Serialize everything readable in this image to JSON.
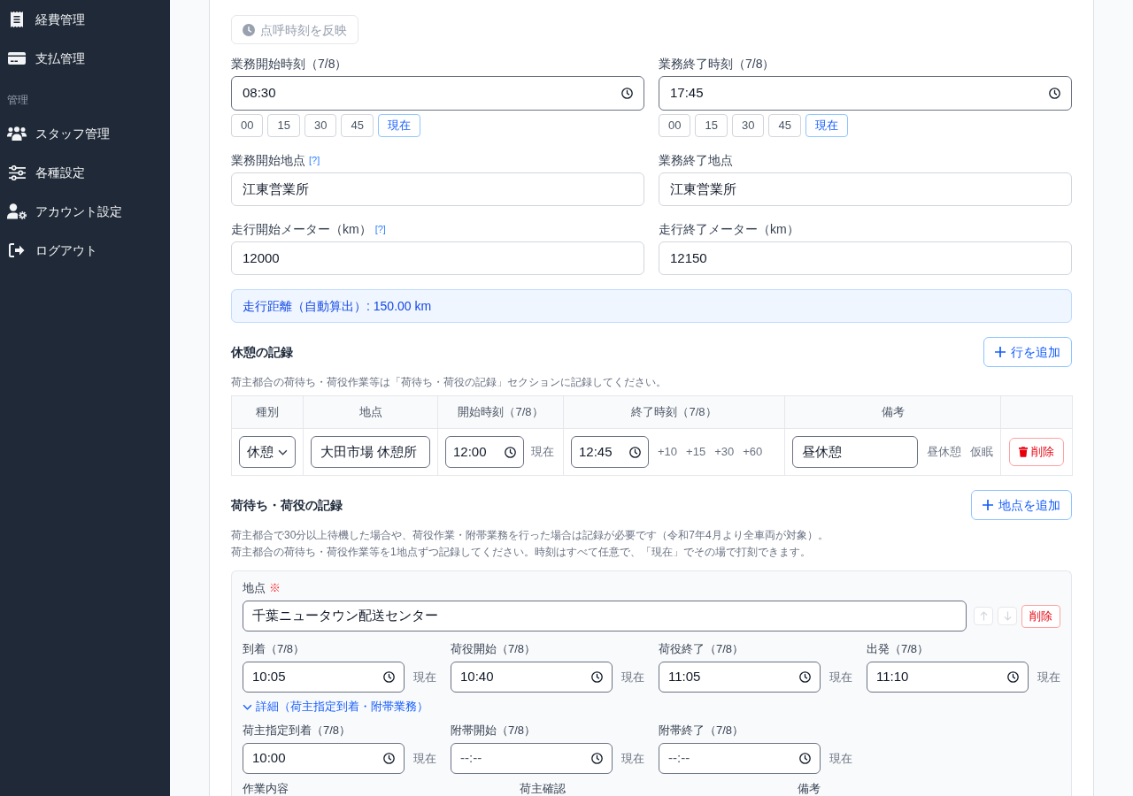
{
  "sidebar": {
    "items": [
      {
        "kind": "link",
        "label": "経費管理",
        "selected": false
      },
      {
        "kind": "link",
        "label": "支払管理",
        "selected": false
      },
      {
        "kind": "section",
        "label": "管理"
      },
      {
        "kind": "link",
        "label": "スタッフ管理",
        "selected": false
      },
      {
        "kind": "link",
        "label": "各種設定",
        "selected": false
      },
      {
        "kind": "link",
        "label": "アカウント設定",
        "selected": false
      },
      {
        "kind": "link",
        "label": "ログアウト",
        "selected": false
      }
    ]
  },
  "roll_call_button": {
    "label": "点呼時刻を反映",
    "disabled": true
  },
  "work_fields": [
    {
      "kind": "time",
      "label": "業務開始時刻（7/8）",
      "value": "08:30",
      "quick_buttons": [
        {
          "kind": "minute",
          "label": "00"
        },
        {
          "kind": "minute",
          "label": "15"
        },
        {
          "kind": "minute",
          "label": "30"
        },
        {
          "kind": "minute",
          "label": "45"
        },
        {
          "kind": "now",
          "label": "現在"
        }
      ]
    },
    {
      "kind": "time",
      "label": "業務終了時刻（7/8）",
      "value": "17:45",
      "quick_buttons": [
        {
          "kind": "minute",
          "label": "00"
        },
        {
          "kind": "minute",
          "label": "15"
        },
        {
          "kind": "minute",
          "label": "30"
        },
        {
          "kind": "minute",
          "label": "45"
        },
        {
          "kind": "now",
          "label": "現在"
        }
      ]
    },
    {
      "kind": "text",
      "label": "業務開始地点",
      "help": "[?]",
      "value": "江東営業所"
    },
    {
      "kind": "text",
      "label": "業務終了地点",
      "value": "江東営業所"
    },
    {
      "kind": "text",
      "label": "走行開始メーター（km）",
      "help": "[?]",
      "value": "12000"
    },
    {
      "kind": "text",
      "label": "走行終了メーター（km）",
      "value": "12150"
    }
  ],
  "distance_notice": "走行距離（自動算出）: 150.00 km",
  "break_records": {
    "title": "休憩の記録",
    "add_button": "行を追加",
    "note": "荷主都合の荷待ち・荷役作業等は「荷待ち・荷役の記録」セクションに記録してください。",
    "table": {
      "columns": [
        "種別",
        "地点",
        "開始時刻（7/8）",
        "終了時刻（7/8）",
        "備考"
      ],
      "rows": [
        {
          "type": "休憩",
          "location": "大田市場 休憩所",
          "start_time": "12:00",
          "start_now_button": "現在",
          "end_time": "12:45",
          "end_offsets": [
            "+10",
            "+15",
            "+30",
            "+60"
          ],
          "remark": "昼休憩",
          "remark_presets": [
            "昼休憩",
            "仮眠"
          ],
          "delete_button": "削除"
        }
      ]
    }
  },
  "waiting_records": {
    "title": "荷待ち・荷役の記録",
    "add_button": "地点を追加",
    "notes": [
      "荷主都合で30分以上待機した場合や、荷役作業・附帯業務を行った場合は記録が必要です（令和7年4月より全車両が対象）。",
      "荷主都合の荷待ち・荷役作業等を1地点ずつ記録してください。時刻はすべて任意で、「現在」でその場で打刻できます。"
    ],
    "stops": [
      {
        "location_label": "地点",
        "required_mark": "※",
        "location": "千葉ニュータウン配送センター",
        "move_up": {
          "disabled": true
        },
        "move_down": {
          "disabled": true
        },
        "delete_button": "削除",
        "times": [
          {
            "label": "到着（7/8）",
            "value": "10:05",
            "now_button": "現在"
          },
          {
            "label": "荷役開始（7/8）",
            "value": "10:40",
            "now_button": "現在"
          },
          {
            "label": "荷役終了（7/8）",
            "value": "11:05",
            "now_button": "現在"
          },
          {
            "label": "出発（7/8）",
            "value": "11:10",
            "now_button": "現在"
          }
        ],
        "details_toggle": {
          "label": "詳細（荷主指定到着・附帯業務）",
          "expanded": true
        },
        "detail_times": [
          {
            "label": "荷主指定到着（7/8）",
            "value": "10:00",
            "now_button": "現在"
          },
          {
            "label": "附帯開始（7/8）",
            "placeholder": "--:--",
            "now_button": "現在"
          },
          {
            "label": "附帯終了（7/8）",
            "placeholder": "--:--",
            "now_button": "現在"
          }
        ],
        "extra_labels": [
          "作業内容",
          "荷主確認",
          "備考"
        ]
      }
    ]
  }
}
